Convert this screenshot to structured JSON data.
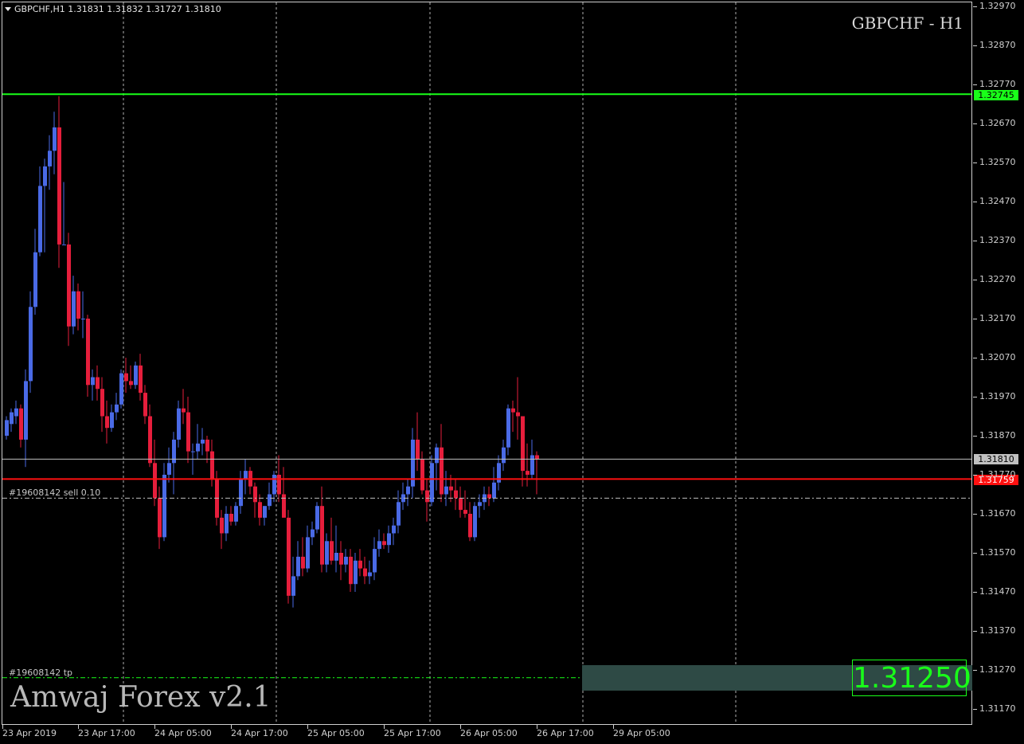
{
  "window": {
    "symbol_info": "GBPCHF,H1  1.31831 1.31832 1.31727 1.31810",
    "corner_title": "GBPCHF - H1",
    "brand": "Amwaj Forex v2.1"
  },
  "orders": {
    "sell_label": "#19608142 sell 0.10",
    "tp_label": "#19608142 tp",
    "tp_price_display": "1.31250"
  },
  "price_tags": {
    "resistance": "1.32745",
    "bid": "1.31810",
    "support_red": "1.31759"
  },
  "colors": {
    "background": "#000000",
    "bull_candle": "#4a6ae6",
    "bear_candle": "#e61e3c",
    "resistance_line": "#19ff19",
    "red_line": "#ff1010",
    "bid_line": "#c0c0c0",
    "tp_box": "#2e4a45",
    "tp_text": "#19ff19"
  },
  "chart_data": {
    "type": "candlestick",
    "symbol": "GBPCHF",
    "timeframe": "H1",
    "y_axis_ticks": [
      "1.32970",
      "1.32870",
      "1.32770",
      "1.32670",
      "1.32570",
      "1.32470",
      "1.32370",
      "1.32270",
      "1.32170",
      "1.32070",
      "1.31970",
      "1.31870",
      "1.31770",
      "1.31670",
      "1.31570",
      "1.31470",
      "1.31370",
      "1.31270",
      "1.31170"
    ],
    "ylim": [
      1.3113,
      1.3298
    ],
    "x_axis_labels": [
      "23 Apr 2019",
      "23 Apr 17:00",
      "24 Apr 05:00",
      "24 Apr 17:00",
      "25 Apr 05:00",
      "25 Apr 17:00",
      "26 Apr 05:00",
      "26 Apr 17:00",
      "29 Apr 05:00"
    ],
    "horizontal_lines": [
      {
        "name": "resistance",
        "price": 1.32745
      },
      {
        "name": "bid",
        "price": 1.3181
      },
      {
        "name": "sell",
        "price": 1.31759
      },
      {
        "name": "order_open",
        "price": 1.3171
      },
      {
        "name": "take_profit",
        "price": 1.3125
      }
    ],
    "candles": [
      [
        1.3187,
        1.3192,
        1.3186,
        1.3191
      ],
      [
        1.319,
        1.3194,
        1.3188,
        1.3193
      ],
      [
        1.3192,
        1.3196,
        1.319,
        1.3194
      ],
      [
        1.3194,
        1.3195,
        1.3184,
        1.3186
      ],
      [
        1.3186,
        1.3204,
        1.3179,
        1.3201
      ],
      [
        1.3201,
        1.3224,
        1.3198,
        1.322
      ],
      [
        1.322,
        1.324,
        1.3218,
        1.3234
      ],
      [
        1.3234,
        1.3256,
        1.3233,
        1.3251
      ],
      [
        1.3251,
        1.3258,
        1.3234,
        1.3256
      ],
      [
        1.3256,
        1.3264,
        1.325,
        1.326
      ],
      [
        1.326,
        1.327,
        1.3254,
        1.3266
      ],
      [
        1.3266,
        1.3274,
        1.323,
        1.3236
      ],
      [
        1.3236,
        1.3252,
        1.3236,
        1.3236
      ],
      [
        1.3236,
        1.3239,
        1.321,
        1.3215
      ],
      [
        1.3215,
        1.3228,
        1.3213,
        1.3224
      ],
      [
        1.3224,
        1.3226,
        1.3214,
        1.3217
      ],
      [
        1.3217,
        1.3224,
        1.3212,
        1.3217
      ],
      [
        1.3217,
        1.3218,
        1.3197,
        1.32
      ],
      [
        1.32,
        1.3204,
        1.3196,
        1.3202
      ],
      [
        1.3202,
        1.3205,
        1.3196,
        1.3199
      ],
      [
        1.3199,
        1.3202,
        1.3188,
        1.3192
      ],
      [
        1.3192,
        1.3196,
        1.3185,
        1.3189
      ],
      [
        1.3189,
        1.3195,
        1.3188,
        1.3193
      ],
      [
        1.3193,
        1.3198,
        1.3191,
        1.3195
      ],
      [
        1.3195,
        1.3204,
        1.3194,
        1.3203
      ],
      [
        1.3203,
        1.3207,
        1.3198,
        1.3201
      ],
      [
        1.3201,
        1.3205,
        1.3199,
        1.32
      ],
      [
        1.32,
        1.3206,
        1.3199,
        1.3205
      ],
      [
        1.3205,
        1.3208,
        1.3196,
        1.3198
      ],
      [
        1.3198,
        1.32,
        1.319,
        1.3192
      ],
      [
        1.3192,
        1.3195,
        1.3179,
        1.318
      ],
      [
        1.318,
        1.3186,
        1.3169,
        1.3171
      ],
      [
        1.3171,
        1.3174,
        1.3158,
        1.3161
      ],
      [
        1.3161,
        1.318,
        1.316,
        1.3177
      ],
      [
        1.3177,
        1.3184,
        1.3175,
        1.318
      ],
      [
        1.318,
        1.3188,
        1.3172,
        1.3186
      ],
      [
        1.3186,
        1.3196,
        1.3184,
        1.3194
      ],
      [
        1.3194,
        1.3199,
        1.319,
        1.3193
      ],
      [
        1.3193,
        1.3197,
        1.318,
        1.3183
      ],
      [
        1.3183,
        1.3185,
        1.3177,
        1.3183
      ],
      [
        1.3183,
        1.319,
        1.3181,
        1.3185
      ],
      [
        1.3185,
        1.3189,
        1.3182,
        1.3186
      ],
      [
        1.3186,
        1.3187,
        1.318,
        1.3183
      ],
      [
        1.3183,
        1.3186,
        1.3174,
        1.3176
      ],
      [
        1.3176,
        1.3178,
        1.3164,
        1.3166
      ],
      [
        1.3166,
        1.3168,
        1.3158,
        1.3162
      ],
      [
        1.3162,
        1.3169,
        1.316,
        1.3167
      ],
      [
        1.3167,
        1.3169,
        1.3164,
        1.3165
      ],
      [
        1.3165,
        1.317,
        1.3164,
        1.3169
      ],
      [
        1.3169,
        1.3178,
        1.3167,
        1.3176
      ],
      [
        1.3176,
        1.3181,
        1.3172,
        1.3178
      ],
      [
        1.3178,
        1.3179,
        1.3172,
        1.3174
      ],
      [
        1.3174,
        1.3175,
        1.3166,
        1.317
      ],
      [
        1.317,
        1.3172,
        1.3164,
        1.3166
      ],
      [
        1.3166,
        1.3169,
        1.3164,
        1.3169
      ],
      [
        1.3169,
        1.3175,
        1.3168,
        1.3172
      ],
      [
        1.3172,
        1.3178,
        1.317,
        1.3177
      ],
      [
        1.3177,
        1.3182,
        1.317,
        1.3172
      ],
      [
        1.3172,
        1.3179,
        1.3167,
        1.3166
      ],
      [
        1.3166,
        1.3168,
        1.3144,
        1.3146
      ],
      [
        1.3146,
        1.3156,
        1.3143,
        1.3151
      ],
      [
        1.3151,
        1.316,
        1.315,
        1.3156
      ],
      [
        1.3156,
        1.3161,
        1.3151,
        1.3153
      ],
      [
        1.3153,
        1.3164,
        1.3152,
        1.3161
      ],
      [
        1.3161,
        1.3165,
        1.3159,
        1.3163
      ],
      [
        1.3163,
        1.317,
        1.3162,
        1.3169
      ],
      [
        1.3169,
        1.3174,
        1.3152,
        1.3154
      ],
      [
        1.3154,
        1.3162,
        1.3152,
        1.316
      ],
      [
        1.316,
        1.3166,
        1.3154,
        1.3155
      ],
      [
        1.3155,
        1.3164,
        1.3152,
        1.3157
      ],
      [
        1.3157,
        1.316,
        1.315,
        1.3154
      ],
      [
        1.3154,
        1.3158,
        1.3152,
        1.3156
      ],
      [
        1.3156,
        1.3158,
        1.3147,
        1.3149
      ],
      [
        1.3149,
        1.3157,
        1.3147,
        1.3155
      ],
      [
        1.3155,
        1.3158,
        1.3151,
        1.3153
      ],
      [
        1.3153,
        1.3156,
        1.3149,
        1.3151
      ],
      [
        1.3151,
        1.3155,
        1.3149,
        1.3152
      ],
      [
        1.3152,
        1.3161,
        1.315,
        1.3158
      ],
      [
        1.3158,
        1.3163,
        1.3156,
        1.316
      ],
      [
        1.316,
        1.3162,
        1.3158,
        1.3159
      ],
      [
        1.3159,
        1.3164,
        1.3157,
        1.3162
      ],
      [
        1.3162,
        1.3166,
        1.3159,
        1.3164
      ],
      [
        1.3164,
        1.3173,
        1.3162,
        1.317
      ],
      [
        1.317,
        1.3175,
        1.3168,
        1.3172
      ],
      [
        1.3172,
        1.3176,
        1.3169,
        1.3174
      ],
      [
        1.3174,
        1.3189,
        1.3171,
        1.3186
      ],
      [
        1.3186,
        1.3193,
        1.3178,
        1.3181
      ],
      [
        1.3181,
        1.3183,
        1.3172,
        1.3173
      ],
      [
        1.3173,
        1.3176,
        1.3165,
        1.317
      ],
      [
        1.317,
        1.3182,
        1.3169,
        1.318
      ],
      [
        1.318,
        1.3185,
        1.3173,
        1.3184
      ],
      [
        1.3184,
        1.319,
        1.317,
        1.3172
      ],
      [
        1.3172,
        1.3178,
        1.3169,
        1.3174
      ],
      [
        1.3174,
        1.3177,
        1.317,
        1.3173
      ],
      [
        1.3173,
        1.3176,
        1.3168,
        1.3171
      ],
      [
        1.3171,
        1.3174,
        1.3166,
        1.3168
      ],
      [
        1.3168,
        1.3173,
        1.3166,
        1.3167
      ],
      [
        1.3167,
        1.317,
        1.316,
        1.3161
      ],
      [
        1.3161,
        1.317,
        1.316,
        1.3169
      ],
      [
        1.3169,
        1.3172,
        1.3166,
        1.317
      ],
      [
        1.317,
        1.3174,
        1.3168,
        1.3172
      ],
      [
        1.3172,
        1.3174,
        1.3169,
        1.3171
      ],
      [
        1.3171,
        1.3179,
        1.317,
        1.3175
      ],
      [
        1.3175,
        1.3182,
        1.3173,
        1.318
      ],
      [
        1.318,
        1.3186,
        1.3178,
        1.3184
      ],
      [
        1.3184,
        1.3195,
        1.3182,
        1.3194
      ],
      [
        1.3194,
        1.3196,
        1.3188,
        1.3193
      ],
      [
        1.3193,
        1.3202,
        1.3186,
        1.3192
      ],
      [
        1.3192,
        1.319,
        1.3174,
        1.3178
      ],
      [
        1.3178,
        1.3185,
        1.3174,
        1.3177
      ],
      [
        1.3177,
        1.3186,
        1.3176,
        1.3182
      ],
      [
        1.3182,
        1.3183,
        1.3172,
        1.3181
      ]
    ]
  }
}
